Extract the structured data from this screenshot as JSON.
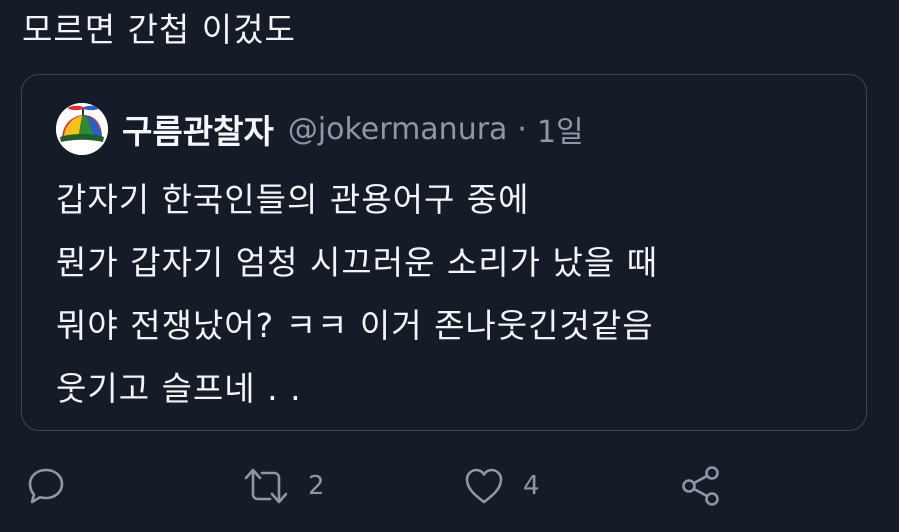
{
  "tweet": {
    "text": "모르면 간첩 이겄도"
  },
  "quote": {
    "display_name": "구름관찰자",
    "handle": "@jokermanura",
    "separator": "·",
    "time": "1일",
    "lines": [
      "갑자기 한국인들의 관용어구 중에",
      "뭔가 갑자기 엄청 시끄러운 소리가 났을 때",
      "뭐야 전쟁났어? ㅋㅋ 이거 존나웃긴것같음",
      "웃기고 슬프네 . ."
    ]
  },
  "actions": {
    "reply_icon": "speech-bubble",
    "retweet_icon": "retweet-arrows",
    "retweet_count": "2",
    "like_icon": "heart",
    "like_count": "4",
    "share_icon": "share-nodes"
  },
  "colors": {
    "background": "#151c28",
    "border": "#3a4452",
    "muted": "#8b98a5",
    "text": "#f2f4f6"
  }
}
